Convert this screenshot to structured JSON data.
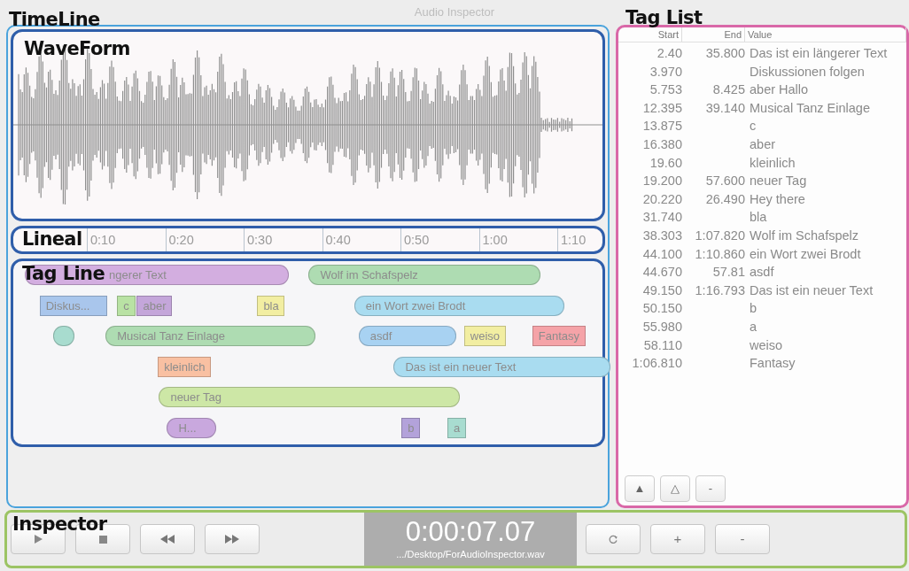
{
  "window": {
    "title": "Audio Inspector"
  },
  "timeline": {
    "label": "TimeLine",
    "waveform": {
      "label": "WaveForm"
    },
    "lineal": {
      "label": "Lineal",
      "ticks": [
        {
          "label": "0:10"
        },
        {
          "label": "0:20"
        },
        {
          "label": "0:30"
        },
        {
          "label": "0:40"
        },
        {
          "label": "0:50"
        },
        {
          "label": "1:00"
        },
        {
          "label": "1:10"
        }
      ]
    },
    "tag_line": {
      "label": "Tag Line"
    }
  },
  "tag_list": {
    "label": "Tag List",
    "columns": [
      "Start",
      "End",
      "Value"
    ],
    "rows": [
      {
        "start": "2.40",
        "end": "35.800",
        "value": "Das ist ein längerer Text",
        "tag": {
          "kind": "range",
          "label": "ngerer Text",
          "color": "#d3aee0"
        }
      },
      {
        "start": "3.970",
        "value": "Diskussionen folgen",
        "tag": {
          "kind": "point",
          "label": "Diskus...",
          "color": "#a9c6ec"
        }
      },
      {
        "start": "5.753",
        "end": "8.425",
        "value": "aber Hallo",
        "tag": {
          "kind": "range",
          "color": "#a8dccf"
        }
      },
      {
        "start": "12.395",
        "end": "39.140",
        "value": "Musical Tanz Einlage",
        "tag": {
          "kind": "range",
          "label": "Musical Tanz Einlage",
          "color": "#aedcb2"
        }
      },
      {
        "start": "13.875",
        "value": "c",
        "tag": {
          "kind": "point",
          "label": "c",
          "color": "#b9e2a4"
        }
      },
      {
        "start": "16.380",
        "value": "aber",
        "tag": {
          "kind": "point",
          "label": "aber",
          "color": "#c4a6da"
        }
      },
      {
        "start": "19.60",
        "value": "kleinlich",
        "tag": {
          "kind": "point",
          "label": "kleinlich",
          "color": "#f9c0a2"
        }
      },
      {
        "start": "19.200",
        "end": "57.600",
        "value": "neuer Tag",
        "tag": {
          "kind": "range",
          "label": "neuer Tag",
          "color": "#cde7a6"
        }
      },
      {
        "start": "20.220",
        "end": "26.490",
        "value": "Hey there",
        "tag": {
          "kind": "range",
          "label": "H...",
          "color": "#c9a8de"
        }
      },
      {
        "start": "31.740",
        "value": "bla",
        "tag": {
          "kind": "point",
          "label": "bla",
          "color": "#f2eea2"
        }
      },
      {
        "start": "38.303",
        "end": "1:07.820",
        "value": "Wolf im Schafspelz",
        "tag": {
          "kind": "range",
          "label": "Wolf im Schafspelz",
          "color": "#aedcb2"
        }
      },
      {
        "start": "44.100",
        "end": "1:10.860",
        "value": "ein Wort zwei Brodt",
        "tag": {
          "kind": "range",
          "label": "ein Wort zwei Brodt",
          "color": "#a9dcf0"
        }
      },
      {
        "start": "44.670",
        "end": "57.81",
        "value": "asdf",
        "tag": {
          "kind": "range",
          "label": "asdf",
          "color": "#a8d2f2"
        }
      },
      {
        "start": "49.150",
        "end": "1:16.793",
        "value": "Das ist ein neuer Text",
        "tag": {
          "kind": "range",
          "label": "Das ist ein neuer Text",
          "color": "#a9dcf0"
        }
      },
      {
        "start": "50.150",
        "value": "b",
        "tag": {
          "kind": "point",
          "label": "b",
          "color": "#b3a2da"
        }
      },
      {
        "start": "55.980",
        "value": "a",
        "tag": {
          "kind": "point",
          "label": "a",
          "color": "#a8dcd0"
        }
      },
      {
        "start": "58.110",
        "value": "weiso",
        "tag": {
          "kind": "point",
          "label": "weiso",
          "color": "#f2eea2"
        }
      },
      {
        "start": "1:06.810",
        "value": "Fantasy",
        "tag": {
          "kind": "point",
          "label": "Fantasy",
          "color": "#f5a3a8"
        }
      }
    ],
    "buttons": [
      "▲",
      "△",
      "-"
    ]
  },
  "inspector": {
    "label": "Inspector",
    "buttons": [
      {
        "kind": "play"
      },
      {
        "kind": "stop"
      },
      {
        "kind": "rewind"
      },
      {
        "kind": "forward"
      }
    ],
    "time": "0:00:07.07",
    "file": ".../Desktop/ForAudioInspector.wav",
    "actions": [
      {
        "kind": "reload"
      },
      {
        "kind": "text",
        "text": "+"
      },
      {
        "kind": "text",
        "text": "-"
      }
    ]
  }
}
